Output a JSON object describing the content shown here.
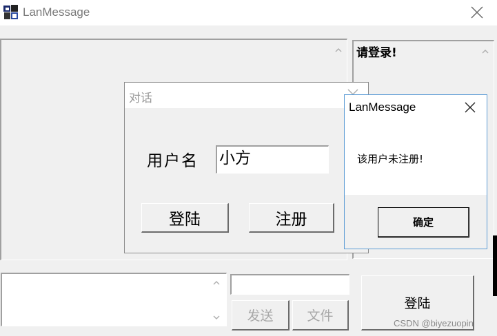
{
  "window": {
    "title": "LanMessage",
    "icon": "app-logo-icon",
    "close_icon": "close-icon"
  },
  "main": {
    "user_list_text": "请登录!",
    "send_button": "发送",
    "file_button": "文件",
    "login_button": "登陆"
  },
  "dialog_login": {
    "title": "对话",
    "username_label": "用户名",
    "username_value": "小方",
    "login_button": "登陆",
    "register_button": "注册"
  },
  "dialog_message": {
    "title": "LanMessage",
    "message": "该用户未注册!",
    "ok_button": "确定"
  },
  "watermark": "CSDN @biyezuopin",
  "colors": {
    "dialog_border": "#5b9bd5",
    "disabled_text": "#a8a8a8"
  }
}
